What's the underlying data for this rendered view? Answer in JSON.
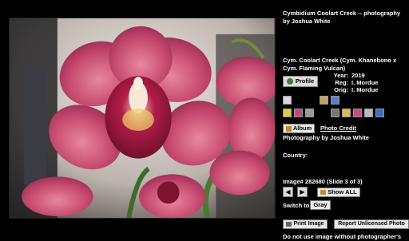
{
  "photo": {
    "alt_subject": "pink cymbidium orchid"
  },
  "sidebar": {
    "title": "Cymbidium Coolart Creek -- photography by Joshua White",
    "plant_name": "Cym. Coolart Creek (Cym. Khanebono x Cym. Flaming Vulcan)",
    "profile_label": "Profile",
    "meta": {
      "year_label": "Year:",
      "year": "2019",
      "reg_label": "Reg:",
      "reg": "I. Mordue",
      "orig_label": "Orig:",
      "orig": "I. Mordue"
    },
    "album_label": "Album",
    "photo_credit_label": "Photo Credit",
    "photographer": "Photography by Joshua White",
    "country_label": "Country:",
    "image_number": "Image# 282680  (Slide 3 of 3)",
    "prev_label": "◀",
    "next_label": "▶",
    "show_all_label": "Show ALL",
    "switch_label": "Switch to:",
    "gray_label": "Gray",
    "print_label": "Print Image",
    "report_label": "Report Unlicensed Photo",
    "notice": "Do not use image without photographer's"
  },
  "colors": {
    "petal": "#c2476e",
    "lip": "#a01840",
    "background": "#000000"
  }
}
